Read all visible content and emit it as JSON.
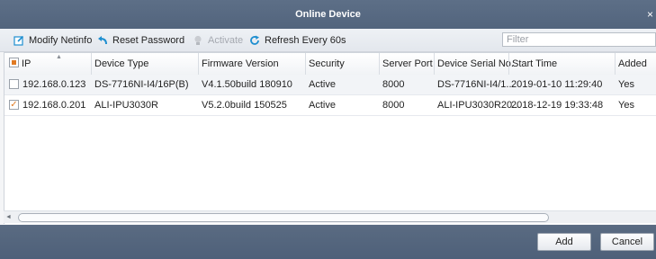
{
  "window": {
    "title": "Online Device",
    "close": "×"
  },
  "toolbar": {
    "modify": {
      "label": "Modify Netinfo",
      "icon": "edit-icon"
    },
    "reset": {
      "label": "Reset Password",
      "icon": "undo-arrow-icon"
    },
    "activate": {
      "label": "Activate",
      "icon": "bulb-icon",
      "state": "disabled"
    },
    "refresh": {
      "label": "Refresh Every 60s",
      "icon": "refresh-icon"
    },
    "filter_placeholder": "Filter"
  },
  "table": {
    "columns": [
      "IP",
      "Device Type",
      "Firmware Version",
      "Security",
      "Server Port",
      "Device Serial No.",
      "Start Time",
      "Added"
    ],
    "rows": [
      {
        "checked": false,
        "ip": "192.168.0.123",
        "type": "DS-7716NI-I4/16P(B)",
        "firmware": "V4.1.50build 180910",
        "security": "Active",
        "port": "8000",
        "serial": "DS-7716NI-I4/1...",
        "start": "2019-01-10 11:29:40",
        "added": "Yes"
      },
      {
        "checked": true,
        "ip": "192.168.0.201",
        "type": "ALI-IPU3030R",
        "firmware": "V5.2.0build 150525",
        "security": "Active",
        "port": "8000",
        "serial": "ALI-IPU3030R20...",
        "start": "2018-12-19 19:33:48",
        "added": "Yes"
      }
    ]
  },
  "buttons": {
    "add": "Add",
    "cancel": "Cancel"
  },
  "colors": {
    "titlebar": "#56687f",
    "accent": "#1f8fd0",
    "check": "#e07a22"
  }
}
